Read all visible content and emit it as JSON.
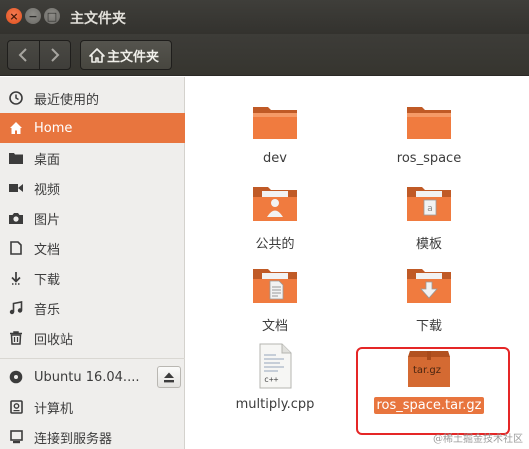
{
  "window": {
    "title": "主文件夹",
    "controls": {
      "close": "×",
      "minimize": "−",
      "maximize": "□"
    }
  },
  "toolbar": {
    "back_icon": "chevron-left-icon",
    "forward_icon": "chevron-right-icon",
    "path_label": "主文件夹",
    "path_icon": "home-icon"
  },
  "sidebar": {
    "items": [
      {
        "label": "最近使用的",
        "icon": "clock-icon"
      },
      {
        "label": "Home",
        "icon": "home-icon",
        "active": true
      },
      {
        "label": "桌面",
        "icon": "folder-icon"
      },
      {
        "label": "视频",
        "icon": "video-icon"
      },
      {
        "label": "图片",
        "icon": "camera-icon"
      },
      {
        "label": "文档",
        "icon": "document-icon"
      },
      {
        "label": "下载",
        "icon": "download-icon"
      },
      {
        "label": "音乐",
        "icon": "music-icon"
      },
      {
        "label": "回收站",
        "icon": "trash-icon"
      }
    ],
    "devices": [
      {
        "label": "Ubuntu 16.04....",
        "icon": "disc-icon",
        "eject_icon": "eject-icon"
      },
      {
        "label": "计算机",
        "icon": "computer-icon"
      },
      {
        "label": "连接到服务器",
        "icon": "server-icon"
      }
    ]
  },
  "files": [
    {
      "name": "dev",
      "type": "folder"
    },
    {
      "name": "ros_space",
      "type": "folder"
    },
    {
      "name": "公共的",
      "type": "folder-public"
    },
    {
      "name": "模板",
      "type": "folder-templates"
    },
    {
      "name": "文档",
      "type": "folder-documents"
    },
    {
      "name": "下载",
      "type": "folder-downloads"
    },
    {
      "name": "multiply.cpp",
      "type": "cpp-file",
      "icon_text": "c++"
    },
    {
      "name": "ros_space.tar.gz",
      "type": "archive",
      "icon_text": "tar.gz",
      "selected": true
    }
  ],
  "colors": {
    "accent": "#e8753e",
    "highlight_border": "#e52626",
    "folder": "#e8753e"
  },
  "watermark": "@稀土掘金技术社区"
}
